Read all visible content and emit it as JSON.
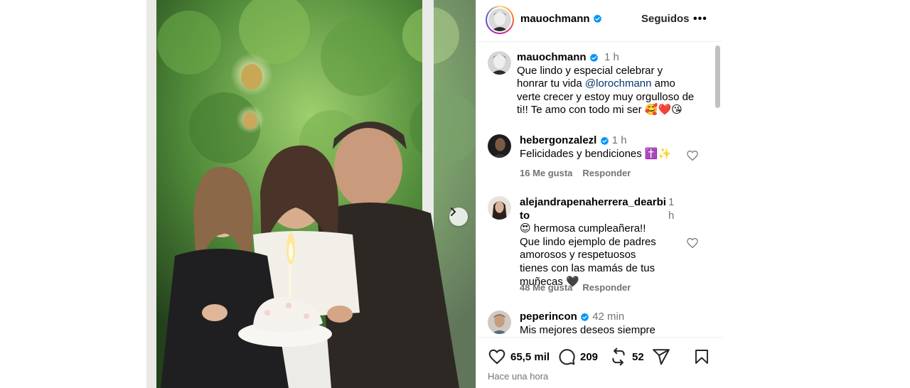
{
  "post": {
    "username": "mauochmann",
    "follow_label": "Seguidos",
    "more_label": "•••",
    "caption": {
      "username": "mauochmann",
      "time": "1 h",
      "text_before": "Que lindo y especial celebrar y honrar tu vida ",
      "mention": "@lorochmann",
      "text_after": " amo verte crecer y estoy muy orgulloso de ti!! Te amo con todo mi ser 🥰❤️😘"
    },
    "comments": [
      {
        "username": "hebergonzalezl",
        "time": "1 h",
        "text": "Felicidades y bendiciones ✝️✨",
        "likes": "16 Me gusta",
        "reply": "Responder"
      },
      {
        "username_line1": "alejandrapenaherrera_dearbi",
        "username_line2": "to",
        "time_line1": "1",
        "time_line2": "h",
        "text": "😍 hermosa cumpleañera!! Que lindo ejemplo de padres amorosos y respetuosos tienes con las mamás de tus muñecas 🖤",
        "likes": "48 Me gusta",
        "reply": "Responder"
      },
      {
        "username": "peperincon",
        "time": "42 min",
        "text": "Mis mejores deseos siempre"
      }
    ],
    "stats": {
      "likes": "65,5 mil",
      "comments": "209",
      "reposts": "52"
    },
    "posted": "Hace una hora"
  },
  "icons": [
    "verified-badge-icon",
    "heart-icon",
    "comment-icon",
    "repost-icon",
    "share-icon",
    "save-icon",
    "chevron-right-icon",
    "more-icon"
  ],
  "colors": {
    "verified": "#0095f6",
    "mention": "#00376b",
    "muted": "#737373"
  }
}
